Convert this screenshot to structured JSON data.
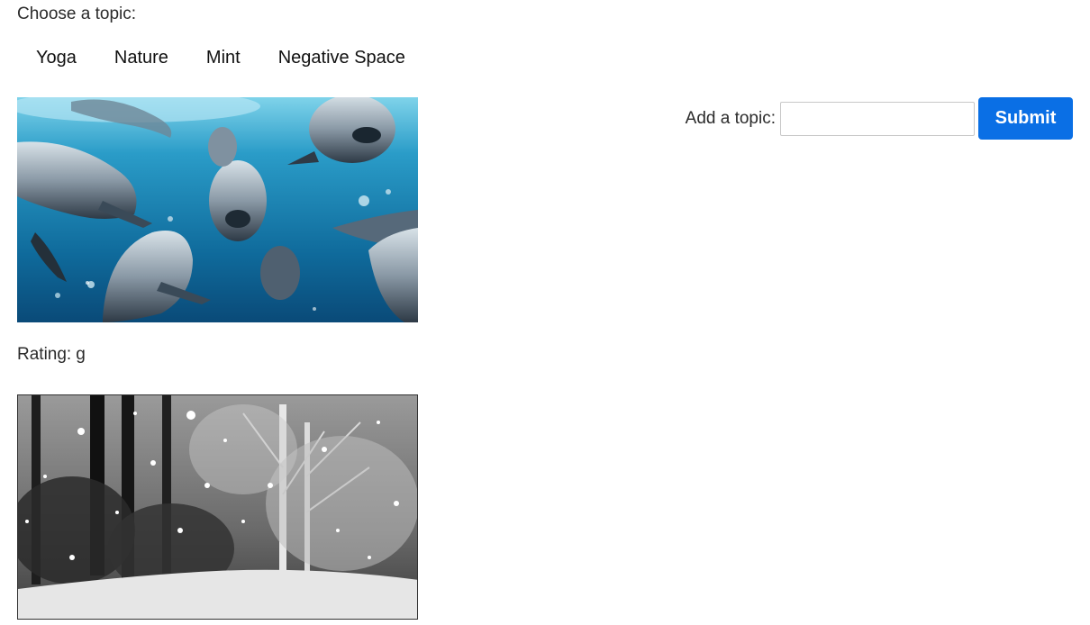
{
  "header": {
    "choose_label": "Choose a topic:"
  },
  "topics": [
    {
      "label": "Yoga"
    },
    {
      "label": "Nature"
    },
    {
      "label": "Mint"
    },
    {
      "label": "Negative Space"
    }
  ],
  "gifs": [
    {
      "subject": "dolphins-underwater",
      "rating_label": "Rating:",
      "rating_value": "g"
    },
    {
      "subject": "snowy-forest"
    }
  ],
  "add_topic": {
    "label": "Add a topic:",
    "value": "",
    "placeholder": "",
    "submit_label": "Submit"
  },
  "colors": {
    "submit_bg": "#0a6fe5",
    "water_light": "#5cc2e0",
    "water_dark": "#0a4a78"
  }
}
